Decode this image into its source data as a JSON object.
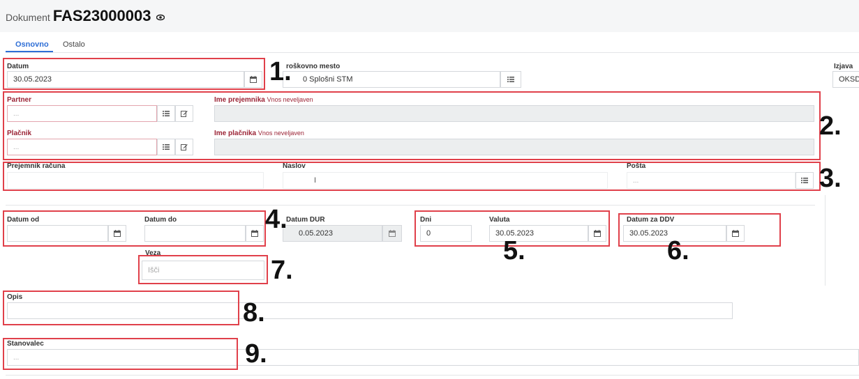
{
  "header": {
    "label": "Dokument",
    "doc_number": "FAS23000003"
  },
  "tabs": [
    {
      "label": "Osnovno"
    },
    {
      "label": "Ostalo"
    }
  ],
  "fields": {
    "datum": {
      "label": "Datum",
      "value": "30.05.2023"
    },
    "stroskovno_mesto": {
      "label": "roškovno mesto",
      "value": "0 Splošni STM",
      "value_prefix": "1"
    },
    "izjava": {
      "label": "Izjava",
      "value": "OKSD"
    },
    "partner": {
      "label": "Partner",
      "placeholder": "..."
    },
    "ime_prejemnika": {
      "label": "Ime prejemnika",
      "hint": "Vnos neveljaven"
    },
    "placnik": {
      "label": "Plačnik",
      "placeholder": "..."
    },
    "ime_placnika": {
      "label": "Ime plačnika",
      "hint": "Vnos neveljaven"
    },
    "prejemnik_racuna": {
      "label": "Prejemnik računa"
    },
    "naslov": {
      "label": "Naslov",
      "cursor": "I"
    },
    "posta": {
      "label": "Pošta",
      "placeholder": "..."
    },
    "datum_od": {
      "label": "Datum od"
    },
    "datum_do": {
      "label": "Datum do"
    },
    "datum_dur": {
      "label": "Datum DUR",
      "value_prefix": "3",
      "value": "0.05.2023"
    },
    "dni": {
      "label": "Dni",
      "value": "0"
    },
    "valuta": {
      "label": "Valuta",
      "value": "30.05.2023"
    },
    "datum_za_ddv": {
      "label": "Datum za DDV",
      "value": "30.05.2023"
    },
    "veza": {
      "label": "Veza",
      "placeholder": "Išči"
    },
    "opis": {
      "label": "Opis"
    },
    "stanovalec": {
      "label": "Stanovalec",
      "placeholder": "..."
    }
  },
  "annotations": {
    "n1": "1.",
    "n2": "2.",
    "n3": "3.",
    "n4": "4.",
    "n5": "5.",
    "n6": "6.",
    "n7": "7.",
    "n8": "8.",
    "n9": "9."
  },
  "colors": {
    "accent": "#2f6fd6",
    "highlight": "#e0404a",
    "required": "#9b2335"
  },
  "icons": [
    "eye-icon",
    "calendar-icon",
    "list-icon",
    "edit-icon"
  ]
}
